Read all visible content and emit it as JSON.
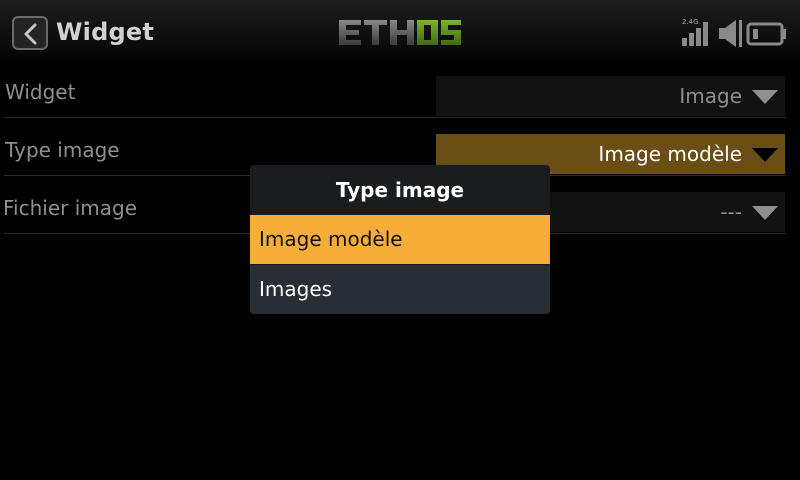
{
  "header": {
    "title": "Widget",
    "brand": "ETHOS",
    "band_label": "2.4G",
    "accent_color": "#5b8f22"
  },
  "rows": [
    {
      "label": "Widget",
      "value": "Image"
    },
    {
      "label": "Type image",
      "value": "Image modèle"
    },
    {
      "label": "Fichier image",
      "value": "---"
    }
  ],
  "popup": {
    "title": "Type image",
    "options": [
      "Image modèle",
      "Images"
    ],
    "selected": "Image modèle",
    "highlight_color": "#f7ad38"
  }
}
